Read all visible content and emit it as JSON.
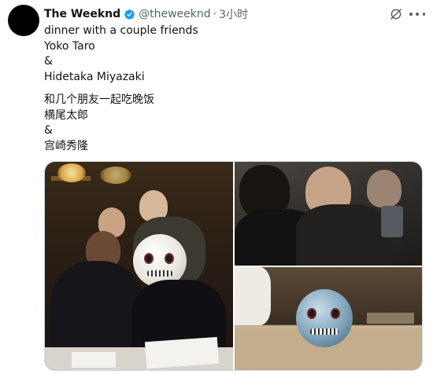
{
  "author": {
    "display_name": "The Weeknd",
    "handle": "@theweeknd",
    "separator": "·",
    "timestamp": "3小时",
    "verified_icon": "verified-badge-icon",
    "avatar_color": "#000000"
  },
  "tweet": {
    "lines_en": [
      "dinner with a couple friends",
      "Yoko Taro",
      "&",
      "Hidetaka Miyazaki"
    ],
    "lines_zh": [
      "和几个朋友一起吃晚饭",
      "横尾太郎",
      "&",
      "宫崎秀隆"
    ]
  },
  "actions": {
    "grok_icon": "grok-icon",
    "more_icon": "more-options-icon"
  },
  "media": {
    "photo_count": 3
  },
  "colors": {
    "text_primary": "#0f1419",
    "text_secondary": "#536471",
    "verified_blue": "#1d9bf0",
    "border": "#cfd9de"
  }
}
